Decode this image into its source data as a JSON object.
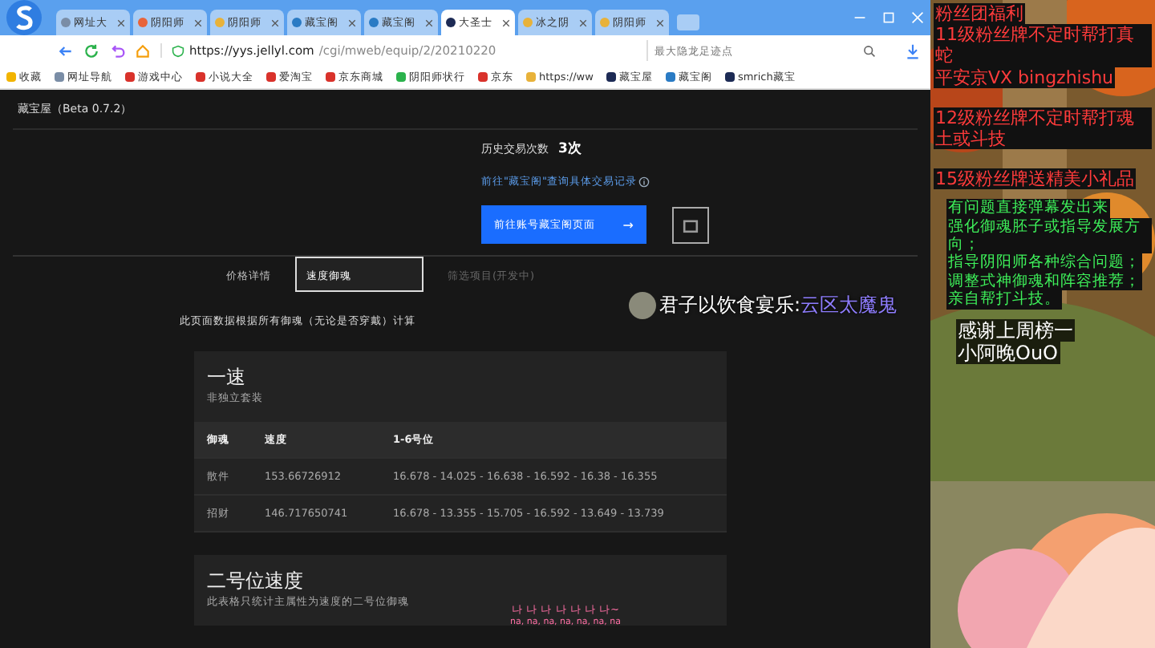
{
  "browser": {
    "tabs": [
      {
        "title": "网址大",
        "selected": false
      },
      {
        "title": "阴阳师",
        "selected": false
      },
      {
        "title": "阴阳师",
        "selected": false
      },
      {
        "title": "藏宝阁",
        "selected": false
      },
      {
        "title": "藏宝阁",
        "selected": false
      },
      {
        "title": "大圣士",
        "selected": true
      },
      {
        "title": "冰之阴",
        "selected": false
      },
      {
        "title": "阴阳师",
        "selected": false
      }
    ],
    "url_host": "https://yys.jellyl.com",
    "url_path": "/cgi/mweb/equip/2/20210220",
    "search_placeholder": "最大隐龙足迹点",
    "bookmarks": [
      "收藏",
      "网址导航",
      "游戏中心",
      "小说大全",
      "爱淘宝",
      "京东商城",
      "阴阳师状行",
      "京东",
      "https://ww",
      "藏宝屋",
      "藏宝阁",
      "smrich藏宝"
    ]
  },
  "page": {
    "header": "藏宝屋（Beta 0.7.2）",
    "history_label": "历史交易次数",
    "history_count": "3次",
    "record_link": "前往\"藏宝阁\"查询具体交易记录",
    "account_button": "前往账号藏宝阁页面",
    "button_arrow": "→",
    "tabs": [
      {
        "label": "价格详情",
        "selected": false,
        "disabled": false
      },
      {
        "label": "速度御魂",
        "selected": true,
        "disabled": false
      },
      {
        "label": "筛选项目(开发中)",
        "selected": false,
        "disabled": true
      }
    ],
    "note": "此页面数据根据所有御魂（无论是否穿戴）计算",
    "sections": [
      {
        "title": "一速",
        "subtitle": "非独立套装",
        "table": {
          "columns": [
            "御魂",
            "速度",
            "1-6号位"
          ],
          "rows": [
            [
              "散件",
              "153.66726912",
              "16.678 - 14.025 - 16.638 - 16.592 - 16.38 - 16.355"
            ],
            [
              "招财",
              "146.717650741",
              "16.678 - 13.355 - 15.705 - 16.592 - 13.649 - 13.739"
            ]
          ]
        }
      },
      {
        "title": "二号位速度",
        "subtitle": "此表格只统计主属性为速度的二号位御魂"
      }
    ]
  },
  "overlay": {
    "danmaku_user": "君子以饮食宴乐:",
    "danmaku_text": "云区太魔鬼",
    "lyrics": [
      "나 나 나 나 나 나 나~",
      "na, na, na, na, na, na, na"
    ]
  },
  "stream_panel": {
    "notices": [
      {
        "text": "粉丝团福利",
        "kind": "red"
      },
      {
        "text": "11级粉丝牌不定时帮打真蛇",
        "kind": "red"
      },
      {
        "text": "平安京VX  bingzhishu",
        "kind": "red"
      },
      {
        "text": "12级粉丝牌不定时帮打魂土或斗技",
        "kind": "red"
      },
      {
        "text": "15级粉丝牌送精美小礼品",
        "kind": "red"
      },
      {
        "text": "有问题直接弹幕发出来",
        "kind": "green"
      },
      {
        "text": "强化御魂胚子或指导发展方向；",
        "kind": "green"
      },
      {
        "text": "指导阴阳师各种综合问题；",
        "kind": "green"
      },
      {
        "text": "调整式神御魂和阵容推荐；",
        "kind": "green"
      },
      {
        "text": "亲自帮打斗技。",
        "kind": "green"
      },
      {
        "text": "感谢上周榜一",
        "kind": "white"
      },
      {
        "text": "小阿晚OuO",
        "kind": "white"
      }
    ]
  }
}
